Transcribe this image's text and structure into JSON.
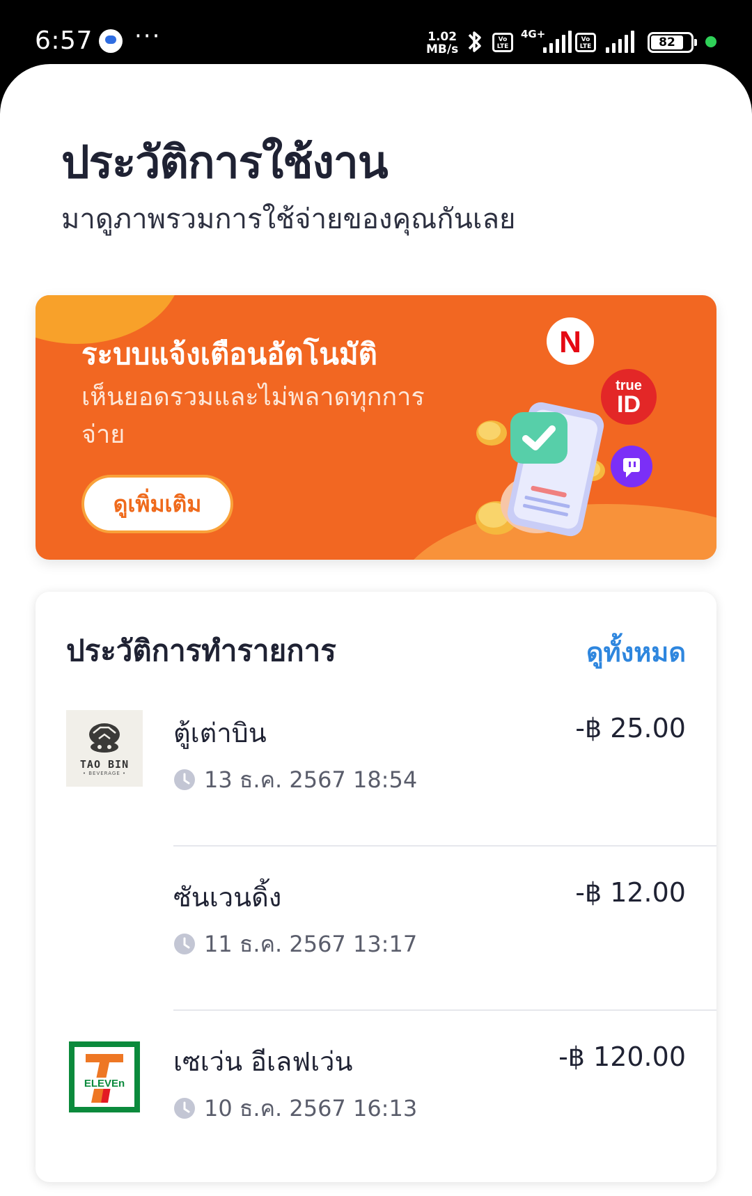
{
  "status_bar": {
    "time": "6:57",
    "network_speed_value": "1.02",
    "network_speed_unit": "MB/s",
    "volte_label": "Vo LTE",
    "network_type": "4G+",
    "battery": "82",
    "icons": [
      "messages-icon",
      "more-dots-icon",
      "bluetooth-icon",
      "signal-icon",
      "battery-icon"
    ]
  },
  "header": {
    "title": "ประวัติการใช้งาน",
    "subtitle": "มาดูภาพรวมการใช้จ่ายของคุณกันเลย"
  },
  "banner": {
    "title": "ระบบแจ้งเตือนอัตโนมัติ",
    "text": "เห็นยอดรวมและไม่พลาดทุกการจ่าย",
    "button_label": "ดูเพิ่มเติม",
    "service_icons": [
      "netflix-icon",
      "trueid-icon",
      "twitch-icon"
    ],
    "netflix_letter": "N",
    "trueid_label": "true",
    "trueid_label2": "ID",
    "colors": {
      "background": "#f26722",
      "accent": "#f8a12a"
    }
  },
  "history": {
    "title": "ประวัติการทำรายการ",
    "see_all_label": "ดูทั้งหมด",
    "transactions": [
      {
        "merchant": "ตู้เต่าบิน",
        "amount": "-฿ 25.00",
        "date": "13 ธ.ค. 2567 18:54",
        "logo": "taobin-logo",
        "logo_text": "TAO BIN",
        "logo_subtext": "• BEVERAGE •"
      },
      {
        "merchant": "ซันเวนดิ้ง",
        "amount": "-฿ 12.00",
        "date": "11 ธ.ค. 2567 13:17",
        "logo": ""
      },
      {
        "merchant": "เซเว่น อีเลฟเว่น",
        "amount": "-฿ 120.00",
        "date": "10 ธ.ค. 2567 16:13",
        "logo": "seven-eleven-logo",
        "logo_text": "ELEVEn"
      }
    ]
  }
}
